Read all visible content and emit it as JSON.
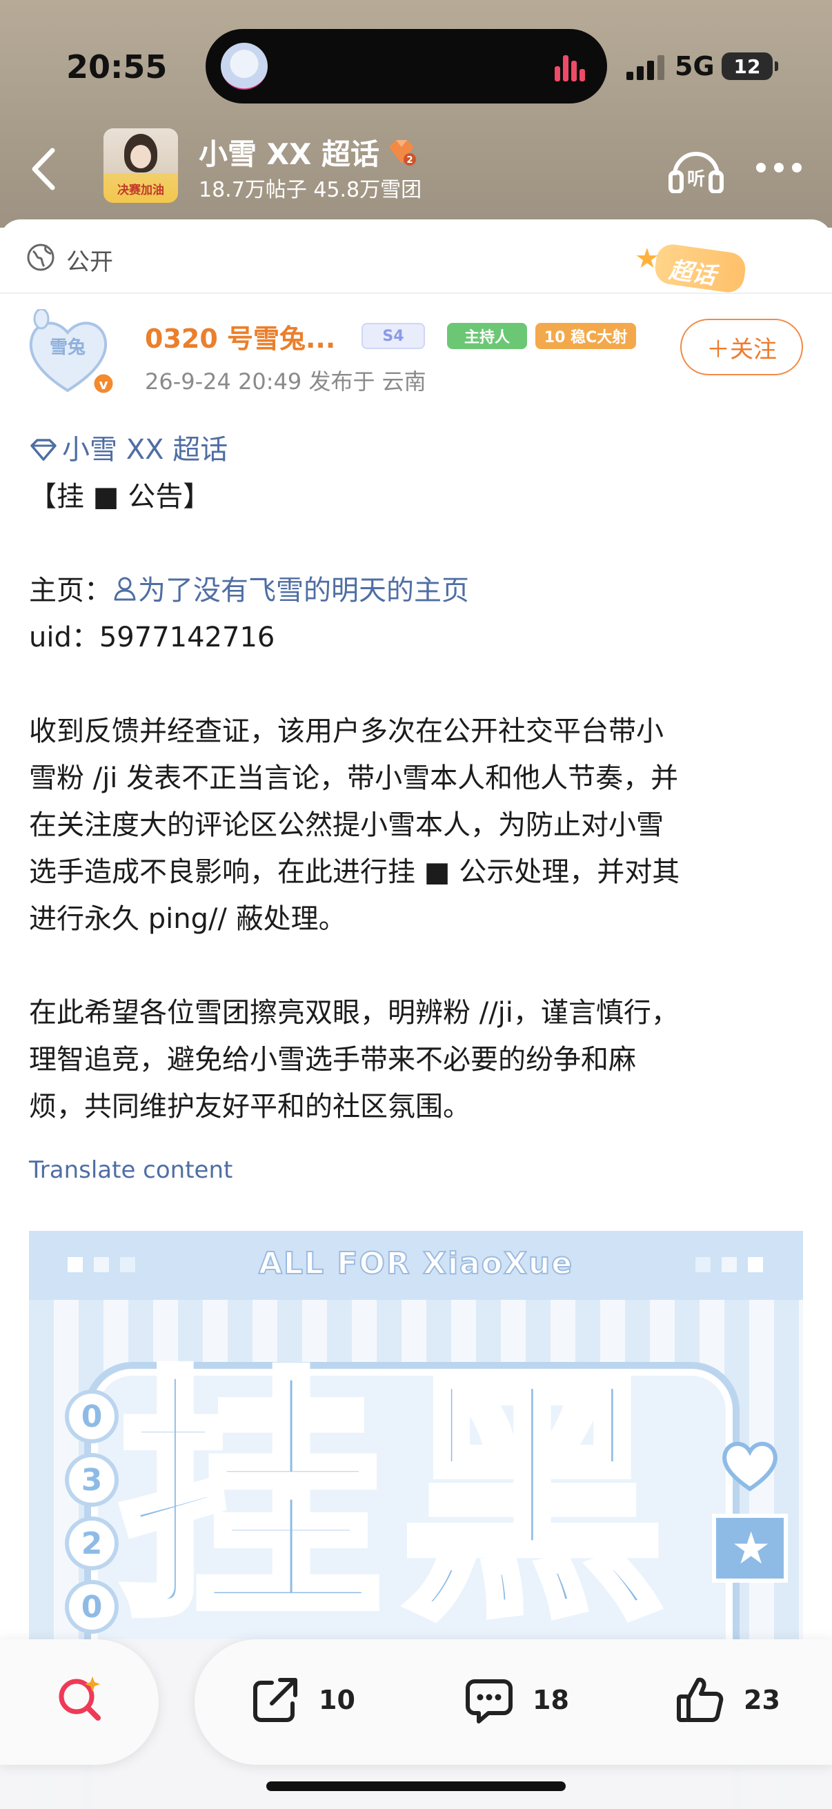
{
  "status_bar": {
    "time": "20:55",
    "network": "5G",
    "battery": "12"
  },
  "topic": {
    "title": "小雪 XX 超话",
    "stats": "18.7万帖子 45.8万雪团",
    "thumb_caption": "决赛加油",
    "level": "2"
  },
  "visibility": {
    "label": "公开",
    "deco_label": "超话"
  },
  "author": {
    "name": "0320 号雪兔...",
    "badge_level": "S4",
    "badge_host": "主持人",
    "badge_rank": "10 稳C大射",
    "meta": "26-9-24 20:49  发布于 云南",
    "follow_label": "＋关注"
  },
  "post": {
    "topic_link": "小雪 XX 超话",
    "heading": "【挂 ■ 公告】",
    "homepage_label": "主页：",
    "homepage_link": "为了没有飞雪的明天的主页",
    "uid_line": "uid：5977142716",
    "para1": [
      "收到反馈并经查证，该用户多次在公开社交平台带小",
      "雪粉 /ji 发表不正当言论，带小雪本人和他人节奏，并",
      "在关注度大的评论区公然提小雪本人，为防止对小雪",
      "选手造成不良影响，在此进行挂 ■ 公示处理，并对其",
      "进行永久 ping// 蔽处理。"
    ],
    "para2": [
      "在此希望各位雪团擦亮双眼，明辨粉 //ji，谨言慎行，",
      "理智追竞，避免给小雪选手带来不必要的纷争和麻",
      "烦，共同维护友好平和的社区氛围。"
    ],
    "translate": "Translate content"
  },
  "image": {
    "banner": "ALL FOR XiaoXue",
    "big_chars": [
      "挂",
      "黑"
    ],
    "numbers": [
      "0",
      "3",
      "2",
      "0"
    ]
  },
  "actions": {
    "share_count": "10",
    "comment_count": "18",
    "like_count": "23"
  },
  "colors": {
    "accent_orange": "#f07a2c",
    "link_blue": "#4f6ea3",
    "header_bg": "#a89c8b",
    "image_blue": "#8ebbe6"
  }
}
